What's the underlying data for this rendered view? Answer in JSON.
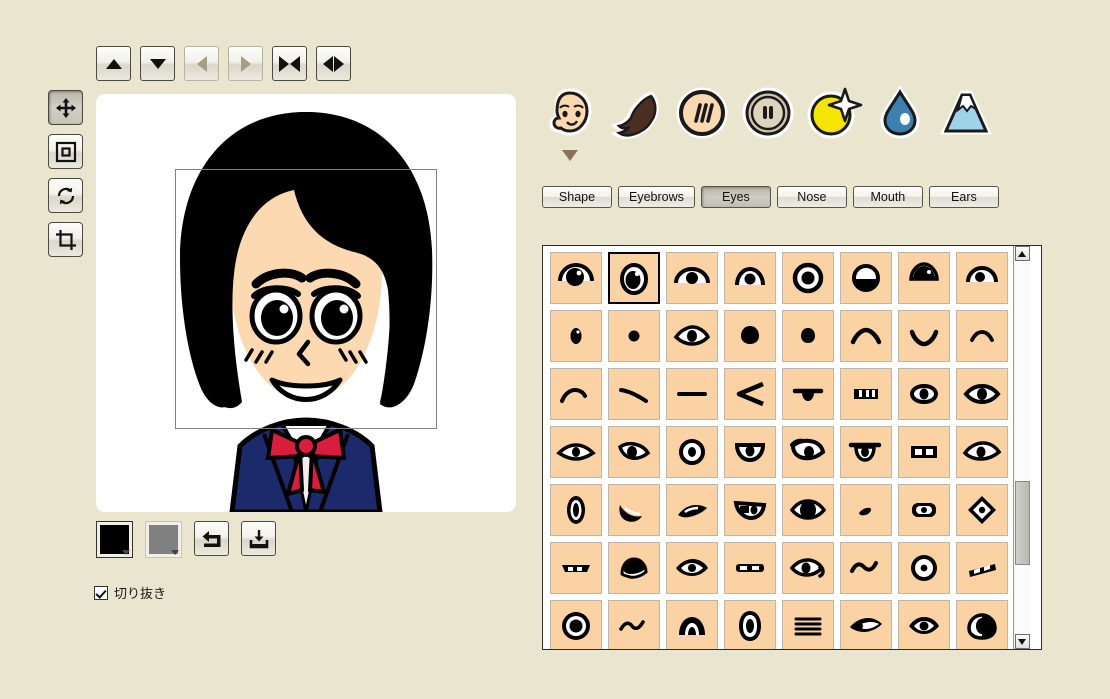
{
  "theme": {
    "background": "#e9e5cf",
    "canvas_bg": "#ffffff",
    "tile_bg": "#fad2a4",
    "panel_border": "#2c2c2c",
    "skin": "#fcd9b0",
    "hair": "#000000",
    "uniform": "#1b2a6b",
    "bow": "#d81e3c",
    "marker": "#8a7255"
  },
  "toolbar": {
    "buttons": [
      {
        "name": "move-up-button",
        "icon": "triangle-up-icon",
        "enabled": true
      },
      {
        "name": "move-down-button",
        "icon": "triangle-down-icon",
        "enabled": true
      },
      {
        "name": "move-left-button",
        "icon": "triangle-left-icon",
        "enabled": false
      },
      {
        "name": "move-right-button",
        "icon": "triangle-right-icon",
        "enabled": false
      },
      {
        "name": "shrink-button",
        "icon": "arrows-inward-icon",
        "enabled": true
      },
      {
        "name": "expand-button",
        "icon": "arrows-outward-icon",
        "enabled": true
      }
    ]
  },
  "tools": {
    "items": [
      {
        "name": "move-tool",
        "icon": "move-arrows-icon",
        "selected": true
      },
      {
        "name": "frame-tool",
        "icon": "nested-square-icon",
        "selected": false
      },
      {
        "name": "rotate-tool",
        "icon": "refresh-arrows-icon",
        "selected": false
      },
      {
        "name": "crop-tool",
        "icon": "crop-icon",
        "selected": false
      }
    ]
  },
  "actions": {
    "primary_color": "#000000",
    "secondary_color": "#808080",
    "buttons": [
      {
        "name": "undo-button",
        "icon": "undo-arrow-icon"
      },
      {
        "name": "save-button",
        "icon": "download-icon"
      }
    ]
  },
  "crop_option": {
    "label": "切り抜き",
    "checked": true
  },
  "categories": [
    {
      "name": "category-face",
      "icon": "baby-face-icon",
      "selected": true
    },
    {
      "name": "category-hair",
      "icon": "hair-tuft-icon",
      "selected": false
    },
    {
      "name": "category-skin",
      "icon": "skin-circle-icon",
      "selected": false
    },
    {
      "name": "category-accessory",
      "icon": "button-icon",
      "selected": false
    },
    {
      "name": "category-effect",
      "icon": "moon-sparkle-icon",
      "selected": false
    },
    {
      "name": "category-water",
      "icon": "water-drop-icon",
      "selected": false
    },
    {
      "name": "category-background",
      "icon": "mountain-icon",
      "selected": false
    }
  ],
  "tabs": [
    {
      "name": "tab-shape",
      "label": "Shape",
      "active": false
    },
    {
      "name": "tab-eyebrows",
      "label": "Eyebrows",
      "active": false
    },
    {
      "name": "tab-eyes",
      "label": "Eyes",
      "active": true
    },
    {
      "name": "tab-nose",
      "label": "Nose",
      "active": false
    },
    {
      "name": "tab-mouth",
      "label": "Mouth",
      "active": false
    },
    {
      "name": "tab-ears",
      "label": "Ears",
      "active": false
    }
  ],
  "parts_grid": {
    "columns": 8,
    "selected_index": 1,
    "items": [
      {
        "i": 0,
        "style": "round-pupil-top-lid"
      },
      {
        "i": 1,
        "style": "tall-oval-pupil-lid"
      },
      {
        "i": 2,
        "style": "small-pupil-arc-lid"
      },
      {
        "i": 3,
        "style": "narrow-arc-lid"
      },
      {
        "i": 4,
        "style": "ring-iris"
      },
      {
        "i": 5,
        "style": "open-ring-half"
      },
      {
        "i": 6,
        "style": "pointed-top-pupil"
      },
      {
        "i": 7,
        "style": "dot-in-arc"
      },
      {
        "i": 8,
        "style": "vertical-oval-dot"
      },
      {
        "i": 9,
        "style": "solid-dot"
      },
      {
        "i": 10,
        "style": "almond-outline-eye"
      },
      {
        "i": 11,
        "style": "teardrop-solid"
      },
      {
        "i": 12,
        "style": "teardrop-small"
      },
      {
        "i": 13,
        "style": "arc-up-thick"
      },
      {
        "i": 14,
        "style": "arc-down-smile"
      },
      {
        "i": 15,
        "style": "arc-up-thin"
      },
      {
        "i": 16,
        "style": "curve-up-left"
      },
      {
        "i": 17,
        "style": "diagonal-stroke"
      },
      {
        "i": 18,
        "style": "horizontal-line"
      },
      {
        "i": 19,
        "style": "arrow-left-angle"
      },
      {
        "i": 20,
        "style": "bar-with-drop"
      },
      {
        "i": 21,
        "style": "lashes-rect"
      },
      {
        "i": 22,
        "style": "oval-outline-pupil"
      },
      {
        "i": 23,
        "style": "wide-oval-pupil"
      },
      {
        "i": 24,
        "style": "flat-eye-outline"
      },
      {
        "i": 25,
        "style": "half-lid-pupil"
      },
      {
        "i": 26,
        "style": "circle-outline-pupil"
      },
      {
        "i": 27,
        "style": "cup-shape-pupil"
      },
      {
        "i": 28,
        "style": "hooked-lid-eye"
      },
      {
        "i": 29,
        "style": "droopy-lid-eye"
      },
      {
        "i": 30,
        "style": "rect-box-eye"
      },
      {
        "i": 31,
        "style": "leaf-eye"
      },
      {
        "i": 32,
        "style": "vertical-ring-eye"
      },
      {
        "i": 33,
        "style": "crescent-wink"
      },
      {
        "i": 34,
        "style": "thin-slit-lashes"
      },
      {
        "i": 35,
        "style": "angular-cup-eye"
      },
      {
        "i": 36,
        "style": "lens-solid-pupil"
      },
      {
        "i": 37,
        "style": "tiny-comma"
      },
      {
        "i": 38,
        "style": "rounded-rect-dot"
      },
      {
        "i": 39,
        "style": "diamond-dot"
      },
      {
        "i": 40,
        "style": "double-brow-lid"
      },
      {
        "i": 41,
        "style": "half-moon-pupil"
      },
      {
        "i": 42,
        "style": "pointed-oval-pupil"
      },
      {
        "i": 43,
        "style": "bar-two-dots"
      },
      {
        "i": 44,
        "style": "hooked-tail-eye"
      },
      {
        "i": 45,
        "style": "wave-line"
      },
      {
        "i": 46,
        "style": "circle-center-dot"
      },
      {
        "i": 47,
        "style": "slanted-bar-dots"
      },
      {
        "i": 48,
        "style": "big-round-pupil"
      },
      {
        "i": 49,
        "style": "wave-thin"
      },
      {
        "i": 50,
        "style": "dome-pupil"
      },
      {
        "i": 51,
        "style": "tall-capsule-pupil"
      },
      {
        "i": 52,
        "style": "stacked-lines"
      },
      {
        "i": 53,
        "style": "sideways-eye"
      },
      {
        "i": 54,
        "style": "wide-lid-pupil"
      },
      {
        "i": 55,
        "style": "half-fill-pupil"
      }
    ]
  },
  "scrollbar": {
    "name": "parts-scrollbar",
    "thumb_position_percent": 76
  }
}
